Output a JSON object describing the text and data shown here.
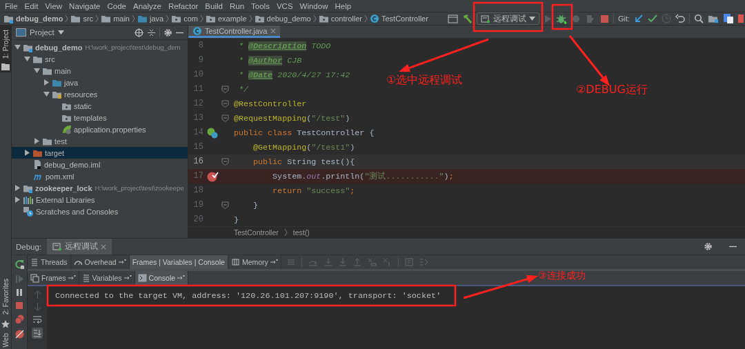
{
  "menu": [
    "File",
    "Edit",
    "View",
    "Navigate",
    "Code",
    "Analyze",
    "Refactor",
    "Build",
    "Run",
    "Tools",
    "VCS",
    "Window",
    "Help"
  ],
  "nav": {
    "crumbs": [
      {
        "label": "debug_demo",
        "kind": "module"
      },
      {
        "label": "src",
        "kind": "folder"
      },
      {
        "label": "main",
        "kind": "folder"
      },
      {
        "label": "java",
        "kind": "source"
      },
      {
        "label": "com",
        "kind": "package"
      },
      {
        "label": "example",
        "kind": "package"
      },
      {
        "label": "debug_demo",
        "kind": "package"
      },
      {
        "label": "controller",
        "kind": "package"
      },
      {
        "label": "TestController",
        "kind": "class"
      }
    ],
    "run_config": "远程调试",
    "git_label": "Git:"
  },
  "side_tabs": {
    "top": "1: Project",
    "bottom": [
      "2: Favorites",
      "Web"
    ]
  },
  "project": {
    "title": "Project",
    "tree": [
      {
        "label": "debug_demo",
        "path": "H:\\work_project\\test\\debug_dem",
        "kind": "module",
        "expanded": true,
        "selected": false,
        "children": [
          {
            "label": "src",
            "kind": "folder",
            "expanded": true,
            "selected": false,
            "children": [
              {
                "label": "main",
                "kind": "folder",
                "expanded": true,
                "selected": false,
                "children": [
                  {
                    "label": "java",
                    "kind": "source",
                    "expanded": false,
                    "selected": false
                  },
                  {
                    "label": "resources",
                    "kind": "resources",
                    "expanded": true,
                    "selected": false,
                    "children": [
                      {
                        "label": "static",
                        "kind": "package",
                        "selected": false
                      },
                      {
                        "label": "templates",
                        "kind": "package",
                        "selected": false
                      },
                      {
                        "label": "application.properties",
                        "kind": "spring",
                        "selected": false
                      }
                    ]
                  }
                ]
              },
              {
                "label": "test",
                "kind": "folder",
                "expanded": false,
                "selected": false
              }
            ]
          },
          {
            "label": "target",
            "kind": "excluded",
            "expanded": false,
            "selected": true
          },
          {
            "label": "debug_demo.iml",
            "kind": "iml",
            "selected": false
          },
          {
            "label": "pom.xml",
            "kind": "maven",
            "selected": false
          }
        ]
      },
      {
        "label": "zookeeper_lock",
        "path": "H:\\work_project\\test\\zookeepe",
        "kind": "module",
        "expanded": false,
        "selected": false
      },
      {
        "label": "External Libraries",
        "kind": "libraries",
        "expanded": false,
        "selected": false
      },
      {
        "label": "Scratches and Consoles",
        "kind": "scratches",
        "selected": false
      }
    ]
  },
  "editor": {
    "tab": "TestController.java",
    "lines": [
      {
        "number": "8",
        "breakpoint": false,
        "caret": false,
        "fold": false,
        "bean": false,
        "tokens": [
          {
            "kind": "c",
            "text": " * "
          },
          {
            "kind": "t",
            "text": "@Description"
          },
          {
            "kind": "c",
            "text": " TODO"
          }
        ]
      },
      {
        "number": "9",
        "breakpoint": false,
        "caret": false,
        "fold": false,
        "bean": false,
        "tokens": [
          {
            "kind": "c",
            "text": " * "
          },
          {
            "kind": "t",
            "text": "@Author"
          },
          {
            "kind": "c",
            "text": " CJB"
          }
        ]
      },
      {
        "number": "10",
        "breakpoint": false,
        "caret": false,
        "fold": false,
        "bean": false,
        "tokens": [
          {
            "kind": "c",
            "text": " * "
          },
          {
            "kind": "t",
            "text": "@Date"
          },
          {
            "kind": "c",
            "text": " 2020/4/27 17:42"
          }
        ]
      },
      {
        "number": "11",
        "breakpoint": false,
        "caret": false,
        "fold": true,
        "bean": false,
        "tokens": [
          {
            "kind": "c",
            "text": " */"
          }
        ]
      },
      {
        "number": "12",
        "breakpoint": false,
        "caret": false,
        "fold": true,
        "bean": false,
        "tokens": [
          {
            "kind": "a",
            "text": "@RestController"
          }
        ]
      },
      {
        "number": "13",
        "breakpoint": false,
        "caret": false,
        "fold": true,
        "bean": false,
        "tokens": [
          {
            "kind": "a",
            "text": "@RequestMapping"
          },
          {
            "kind": "p",
            "text": "("
          },
          {
            "kind": "s",
            "text": "\"/test\""
          },
          {
            "kind": "p",
            "text": ")"
          }
        ]
      },
      {
        "number": "14",
        "breakpoint": false,
        "caret": false,
        "fold": false,
        "bean": true,
        "tokens": [
          {
            "kind": "k",
            "text": "public class "
          },
          {
            "kind": "p",
            "text": "TestController {"
          }
        ]
      },
      {
        "number": "15",
        "breakpoint": false,
        "caret": false,
        "fold": false,
        "bean": false,
        "tokens": [
          {
            "kind": "a",
            "text": "    @GetMapping"
          },
          {
            "kind": "p",
            "text": "("
          },
          {
            "kind": "s",
            "text": "\"/test1\""
          },
          {
            "kind": "p",
            "text": ")"
          }
        ]
      },
      {
        "number": "16",
        "breakpoint": false,
        "caret": true,
        "fold": true,
        "bean": false,
        "tokens": [
          {
            "kind": "k",
            "text": "    public "
          },
          {
            "kind": "p",
            "text": "String test(){"
          }
        ]
      },
      {
        "number": "17",
        "breakpoint": true,
        "caret": false,
        "fold": false,
        "bean": false,
        "tokens": [
          {
            "kind": "p",
            "text": "        System."
          },
          {
            "kind": "f",
            "text": "out"
          },
          {
            "kind": "p",
            "text": ".println("
          },
          {
            "kind": "s",
            "text": "\"测试...........\""
          },
          {
            "kind": "p",
            "text": ")"
          },
          {
            "kind": "k",
            "text": ";"
          }
        ]
      },
      {
        "number": "18",
        "breakpoint": false,
        "caret": false,
        "fold": false,
        "bean": false,
        "tokens": [
          {
            "kind": "k",
            "text": "        return "
          },
          {
            "kind": "s",
            "text": "\"success\""
          },
          {
            "kind": "k",
            "text": ";"
          }
        ]
      },
      {
        "number": "19",
        "breakpoint": false,
        "caret": false,
        "fold": true,
        "bean": false,
        "tokens": [
          {
            "kind": "p",
            "text": "    }"
          }
        ]
      },
      {
        "number": "20",
        "breakpoint": false,
        "caret": false,
        "fold": false,
        "bean": false,
        "tokens": [
          {
            "kind": "p",
            "text": "}"
          }
        ]
      }
    ],
    "breadcrumbs": [
      "TestController",
      "test()"
    ]
  },
  "debug": {
    "title": "Debug:",
    "session": "远程调试",
    "tabs": [
      {
        "label": "Threads",
        "kind": "threads",
        "selected": false
      },
      {
        "label": "Overhead",
        "kind": "overhead",
        "selected": false
      },
      {
        "label": "Frames | Variables | Console",
        "kind": "layout",
        "selected": true
      },
      {
        "label": "Memory",
        "kind": "memory",
        "selected": false
      }
    ],
    "subtabs": [
      {
        "label": "Frames",
        "kind": "frames",
        "selected": false
      },
      {
        "label": "Variables",
        "kind": "variables",
        "selected": false
      },
      {
        "label": "Console",
        "kind": "console",
        "selected": true
      }
    ],
    "console": [
      "Connected to the target VM, address: '120.26.101.207:9190', transport: 'socket'"
    ]
  },
  "annotations": [
    "①选中远程调试",
    "②DEBUG运行",
    "③连接成功"
  ]
}
